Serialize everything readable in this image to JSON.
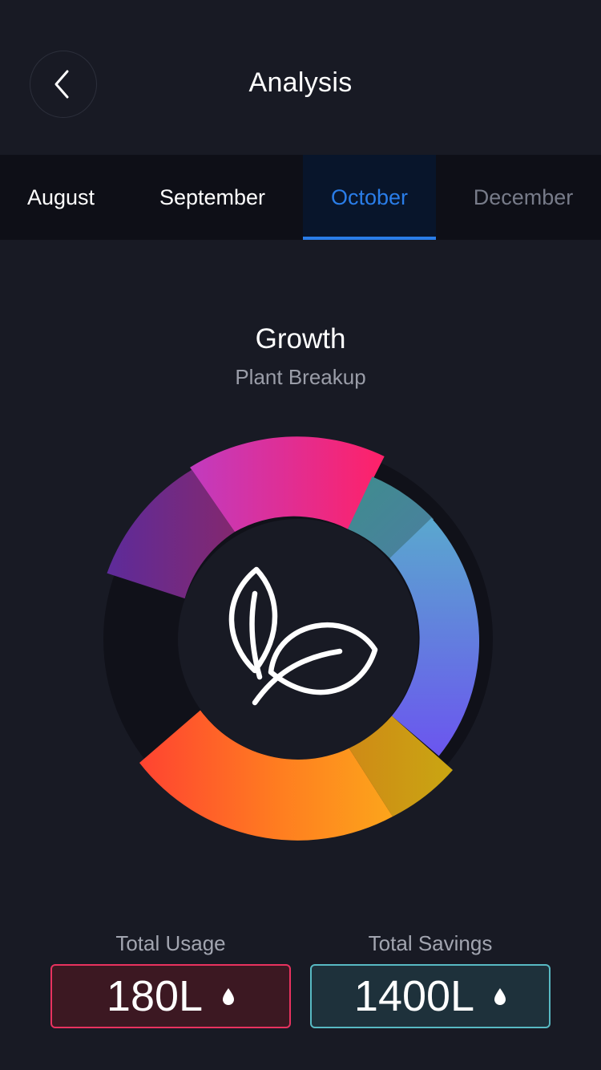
{
  "header": {
    "title": "Analysis",
    "back_icon": "chevron-left-icon"
  },
  "tabs": [
    {
      "label": "August",
      "state": "normal"
    },
    {
      "label": "September",
      "state": "normal"
    },
    {
      "label": "October",
      "state": "active"
    },
    {
      "label": "December",
      "state": "muted"
    }
  ],
  "section": {
    "title": "Growth",
    "subtitle": "Plant Breakup",
    "center_icon": "leaves-icon"
  },
  "stats": {
    "usage": {
      "label": "Total Usage",
      "value": "180L",
      "icon": "water-drop-icon"
    },
    "savings": {
      "label": "Total Savings",
      "value": "1400L",
      "icon": "water-drop-icon"
    }
  },
  "colors": {
    "background": "#181a24",
    "accent": "#2a7de8",
    "usage_border": "#e8325f",
    "savings_border": "#58b9c3"
  }
}
